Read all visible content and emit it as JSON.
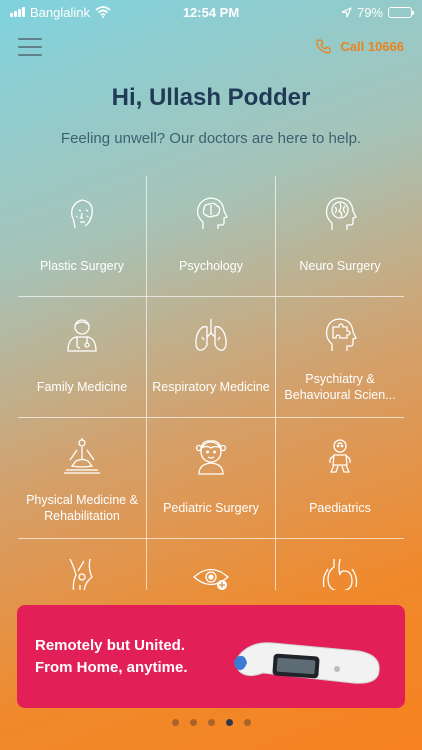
{
  "status_bar": {
    "carrier": "Banglalink",
    "time": "12:54 PM",
    "battery": "79%",
    "battery_level": 0.79
  },
  "header": {
    "call_label": "Call 10666"
  },
  "greeting": "Hi, Ullash Podder",
  "subtitle": "Feeling unwell? Our doctors are here to help.",
  "specialties": [
    {
      "label": "Plastic Surgery",
      "icon": "face-icon"
    },
    {
      "label": "Psychology",
      "icon": "head-brain-icon"
    },
    {
      "label": "Neuro Surgery",
      "icon": "brain-icon"
    },
    {
      "label": "Family Medicine",
      "icon": "doctor-icon"
    },
    {
      "label": "Respiratory Medicine",
      "icon": "lungs-icon"
    },
    {
      "label": "Psychiatry & Behavioural Scien...",
      "icon": "head-puzzle-icon"
    },
    {
      "label": "Physical Medicine & Rehabilitation",
      "icon": "yoga-icon"
    },
    {
      "label": "Pediatric Surgery",
      "icon": "child-icon"
    },
    {
      "label": "Paediatrics",
      "icon": "baby-icon"
    },
    {
      "label": "",
      "icon": "knee-joint-icon"
    },
    {
      "label": "",
      "icon": "eye-icon"
    },
    {
      "label": "",
      "icon": "stomach-icon"
    }
  ],
  "banner": {
    "line1": "Remotely but United.",
    "line2": "From Home, anytime."
  },
  "pagination": {
    "count": 5,
    "active": 4
  }
}
